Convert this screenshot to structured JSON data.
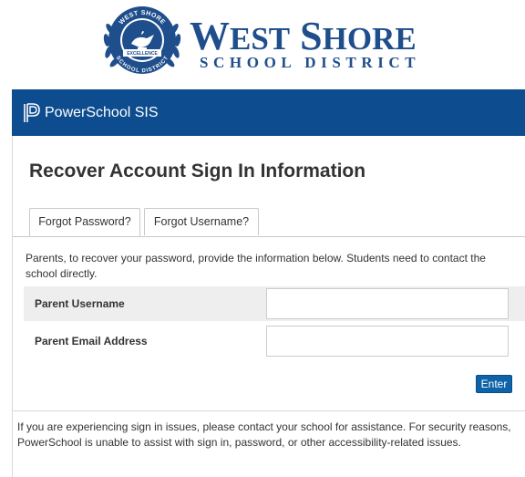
{
  "logo": {
    "title_big_w": "W",
    "title_small_est": "EST",
    "title_big_s": "S",
    "title_small_hore": "HORE",
    "subtitle": "SCHOOL DISTRICT",
    "seal_text_top": "WEST SHORE",
    "seal_text_bottom": "SCHOOL DISTRICT",
    "seal_banner": "EXCELLENCE",
    "brand_color": "#1f4e8c"
  },
  "header": {
    "app_name": "PowerSchool SIS",
    "bar_color": "#0d4c8e"
  },
  "page": {
    "title": "Recover Account Sign In Information"
  },
  "tabs": [
    {
      "label": "Forgot Password?",
      "active": true
    },
    {
      "label": "Forgot Username?",
      "active": false
    }
  ],
  "form": {
    "intro": "Parents, to recover your password, provide the information below. Students need to contact the school directly.",
    "fields": [
      {
        "label": "Parent Username",
        "value": ""
      },
      {
        "label": "Parent Email Address",
        "value": ""
      }
    ],
    "submit_label": "Enter",
    "submit_color": "#0d62a8"
  },
  "help_text": "If you are experiencing sign in issues, please contact your school for assistance. For security reasons, PowerSchool is unable to assist with sign in, password, or other accessibility-related issues."
}
